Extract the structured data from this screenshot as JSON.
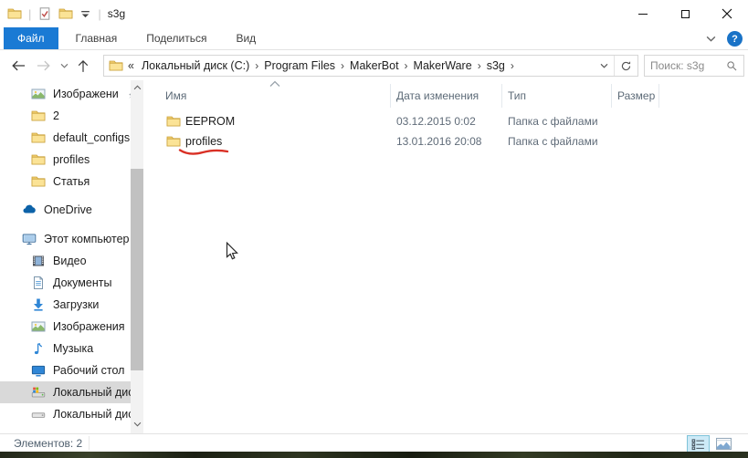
{
  "titlebar": {
    "title": "s3g"
  },
  "window_controls": {
    "icons": [
      "minimize-icon",
      "maximize-icon",
      "close-icon"
    ]
  },
  "qat_icons": [
    "app-folder-icon",
    "properties-check-icon",
    "new-folder-icon",
    "qat-customize-icon"
  ],
  "ribbon": {
    "tabs": [
      {
        "label": "Файл",
        "active": true
      },
      {
        "label": "Главная",
        "active": false
      },
      {
        "label": "Поделиться",
        "active": false
      },
      {
        "label": "Вид",
        "active": false
      }
    ],
    "help_label": "?"
  },
  "navbar": {
    "breadcrumb": {
      "prefix": "«",
      "segments": [
        "Локальный диск (C:)",
        "Program Files",
        "MakerBot",
        "MakerWare",
        "s3g"
      ],
      "separator": "›"
    },
    "search_placeholder": "Поиск: s3g"
  },
  "sidebar": {
    "items": [
      {
        "label": "Изображени",
        "icon": "picture",
        "indent": 1,
        "pinned": true,
        "selected": false,
        "gap_before": 0
      },
      {
        "label": "2",
        "icon": "folder",
        "indent": 1,
        "pinned": false,
        "selected": false,
        "gap_before": 0
      },
      {
        "label": "default_configs",
        "icon": "folder",
        "indent": 1,
        "pinned": false,
        "selected": false,
        "gap_before": 0
      },
      {
        "label": "profiles",
        "icon": "folder",
        "indent": 1,
        "pinned": false,
        "selected": false,
        "gap_before": 0
      },
      {
        "label": "Статья",
        "icon": "folder",
        "indent": 1,
        "pinned": false,
        "selected": false,
        "gap_before": 0
      },
      {
        "label": "OneDrive",
        "icon": "onedrive",
        "indent": 0,
        "pinned": false,
        "selected": false,
        "gap_before": 7
      },
      {
        "label": "Этот компьютер",
        "icon": "computer",
        "indent": 0,
        "pinned": false,
        "selected": false,
        "gap_before": 8
      },
      {
        "label": "Видео",
        "icon": "video",
        "indent": 1,
        "pinned": false,
        "selected": false,
        "gap_before": 0
      },
      {
        "label": "Документы",
        "icon": "document",
        "indent": 1,
        "pinned": false,
        "selected": false,
        "gap_before": 0
      },
      {
        "label": "Загрузки",
        "icon": "download",
        "indent": 1,
        "pinned": false,
        "selected": false,
        "gap_before": 0
      },
      {
        "label": "Изображения",
        "icon": "picture",
        "indent": 1,
        "pinned": false,
        "selected": false,
        "gap_before": 0
      },
      {
        "label": "Музыка",
        "icon": "music",
        "indent": 1,
        "pinned": false,
        "selected": false,
        "gap_before": 0
      },
      {
        "label": "Рабочий стол",
        "icon": "desktop",
        "indent": 1,
        "pinned": false,
        "selected": false,
        "gap_before": 0
      },
      {
        "label": "Локальный дис",
        "icon": "drive-system",
        "indent": 1,
        "pinned": false,
        "selected": true,
        "gap_before": 0
      },
      {
        "label": "Локальный дис",
        "icon": "drive",
        "indent": 1,
        "pinned": false,
        "selected": false,
        "gap_before": 0
      }
    ]
  },
  "main": {
    "sort_column": "Имя",
    "columns": [
      "Имя",
      "Дата изменения",
      "Тип",
      "Размер"
    ],
    "rows": [
      {
        "name": "EEPROM",
        "modified": "03.12.2015 0:02",
        "type": "Папка с файлами",
        "size": "",
        "underlined": false
      },
      {
        "name": "profiles",
        "modified": "13.01.2016 20:08",
        "type": "Папка с файлами",
        "size": "",
        "underlined": true
      }
    ]
  },
  "statusbar": {
    "items_count": "Элементов: 2"
  },
  "view_toggles": {
    "icons": [
      "details-view-icon",
      "thumbnails-view-icon"
    ],
    "selected": "details-view-icon"
  },
  "colors": {
    "accent": "#1a7ad4",
    "folder_yellow": "#f3cf70",
    "underline_red": "#d93025",
    "selection_gray": "#d9d9d9",
    "help_blue": "#1a73c7"
  }
}
